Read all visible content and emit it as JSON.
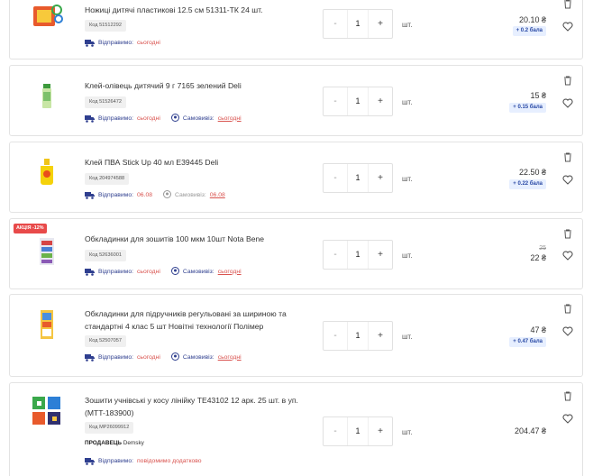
{
  "colors": {
    "accent_blue": "#2f3f8f",
    "date_red": "#d9534f",
    "bonus_bg": "#e7efff",
    "promo_red": "#e84a4a"
  },
  "labels": {
    "unit": "шт.",
    "qty_minus": "-",
    "qty_plus": "+",
    "ship_label": "Відправимо:",
    "pickup_label": "Самовивіз:",
    "seller_label": "ПРОДАВЕЦЬ"
  },
  "items": [
    {
      "title": "Ножиці дитячі пластикові 12.5 см 51311-ТК 24 шт.",
      "code": "Код 51512292",
      "ship": "сьогодні",
      "quantity": "1",
      "price": "20.10 ₴",
      "bonus": "+ 0.2 бала"
    },
    {
      "title": "Клей-олівець дитячий 9 г 7165 зелений Deli",
      "code": "Код 51526472",
      "ship": "сьогодні",
      "pickup": "сьогодні",
      "quantity": "1",
      "price": "15 ₴",
      "bonus": "+ 0.15 бала"
    },
    {
      "title": "Клей ПВА Stick Up 40 мл E39445 Deli",
      "code": "Код 204974588",
      "ship": "06.08",
      "pickup": "06.08",
      "quantity": "1",
      "price": "22.50 ₴",
      "bonus": "+ 0.22 бала"
    },
    {
      "promo": "АКЦІЯ -12%",
      "title": "Обкладинки для зошитів 100 мкм 10шт Nota Bene",
      "code": "Код 52636001",
      "ship": "сьогодні",
      "pickup": "сьогодні",
      "quantity": "1",
      "old_price": "25",
      "price": "22 ₴"
    },
    {
      "title": "Обкладинки для підручників регульовані за шириною та стандартні 4 клас 5 шт Новітні технології Полімер",
      "code": "Код 52507057",
      "ship": "сьогодні",
      "pickup": "сьогодні",
      "quantity": "1",
      "price": "47 ₴",
      "bonus": "+ 0.47 бала"
    },
    {
      "title": "Зошити учнівські у косу лінійку TE43102 12 арк. 25 шт. в уп. (MTT-183900)",
      "code": "Код MP26099912",
      "seller": "Demsky",
      "ship": "повідомимо додатково",
      "quantity": "1",
      "price": "204.47 ₴"
    }
  ]
}
